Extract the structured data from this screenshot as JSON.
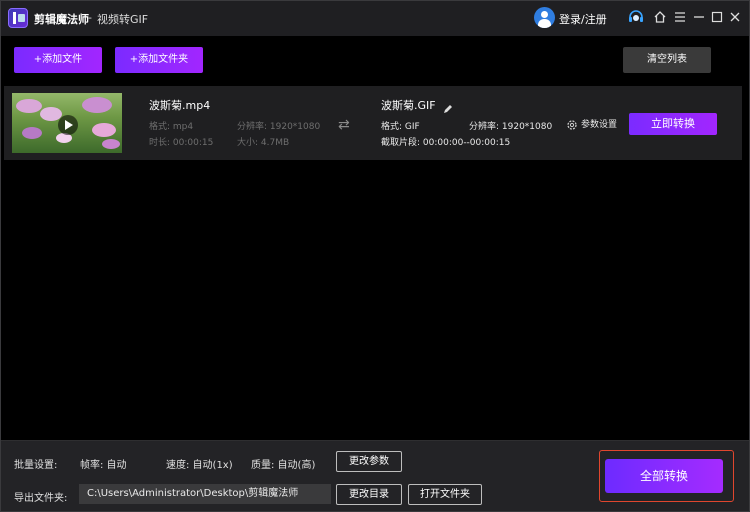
{
  "titlebar": {
    "app_name": "剪辑魔法师",
    "separator": "-",
    "subtitle": "视频转GIF",
    "login_label": "登录/注册",
    "icons": [
      "headset-icon",
      "home-icon",
      "menu-icon",
      "minimize-icon",
      "maximize-icon",
      "close-icon"
    ]
  },
  "toolbar": {
    "add_file_label": "+添加文件",
    "add_folder_label": "+添加文件夹",
    "clear_list_label": "清空列表"
  },
  "file": {
    "source_name": "波斯菊.mp4",
    "source_format": "格式: mp4",
    "source_resolution": "分辨率: 1920*1080",
    "source_duration": "时长: 00:00:15",
    "source_size": "大小: 4.7MB",
    "target_name": "波斯菊.GIF",
    "target_format": "格式: GIF",
    "target_resolution": "分辨率: 1920*1080",
    "target_clip": "截取片段: 00:00:00--00:00:15",
    "param_settings_label": "参数设置",
    "convert_now_label": "立即转换"
  },
  "bottom": {
    "batch_label": "批量设置:",
    "frame_rate": "帧率: 自动",
    "speed": "速度: 自动(1x)",
    "quality": "质量: 自动(高)",
    "change_params_label": "更改参数",
    "export_label": "导出文件夹:",
    "export_path": "C:\\Users\\Administrator\\Desktop\\剪辑魔法师",
    "change_dir_label": "更改目录",
    "open_folder_label": "打开文件夹",
    "convert_all_label": "全部转换"
  },
  "colors": {
    "accent_purple": "#8a2bff",
    "highlight_red": "#e0462e",
    "panel_bg": "#1f1f21"
  }
}
